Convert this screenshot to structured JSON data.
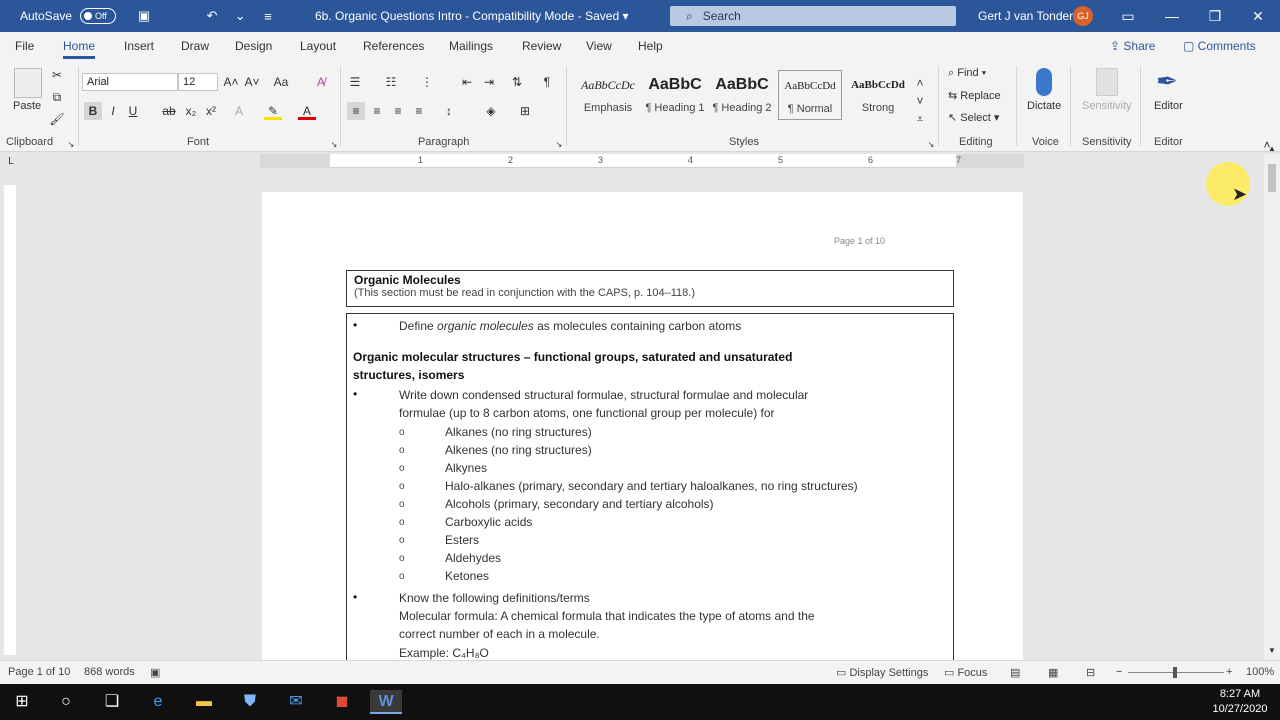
{
  "titlebar": {
    "autosave_label": "AutoSave",
    "autosave_state": "Off",
    "doc_title": "6b. Organic Questions Intro  -  Compatibility Mode  -  Saved",
    "search_placeholder": "Search",
    "user_name": "Gert J van Tonder",
    "user_initials": "GJ"
  },
  "tabs": [
    "File",
    "Home",
    "Insert",
    "Draw",
    "Design",
    "Layout",
    "References",
    "Mailings",
    "Review",
    "View",
    "Help"
  ],
  "active_tab": "Home",
  "share_label": "Share",
  "comments_label": "Comments",
  "ribbon": {
    "clipboard": {
      "paste": "Paste",
      "label": "Clipboard"
    },
    "font": {
      "name": "Arial",
      "size": "12",
      "label": "Font"
    },
    "paragraph": {
      "label": "Paragraph"
    },
    "styles": {
      "label": "Styles",
      "items": [
        {
          "sample": "AaBbCcDc",
          "name": "Emphasis"
        },
        {
          "sample": "AaBbC",
          "name": "¶ Heading 1"
        },
        {
          "sample": "AaBbC",
          "name": "¶ Heading 2"
        },
        {
          "sample": "AaBbCcDd",
          "name": "¶ Normal"
        },
        {
          "sample": "AaBbCcDd",
          "name": "Strong"
        }
      ]
    },
    "editing": {
      "find": "Find",
      "replace": "Replace",
      "select": "Select",
      "label": "Editing"
    },
    "voice": {
      "dictate": "Dictate",
      "label": "Voice"
    },
    "sensitivity": {
      "button": "Sensitivity",
      "label": "Sensitivity"
    },
    "editor": {
      "button": "Editor",
      "label": "Editor"
    }
  },
  "ruler_numbers": [
    "1",
    "2",
    "3",
    "4",
    "5",
    "6",
    "7"
  ],
  "document": {
    "page_header": "Page 1 of 10",
    "box1_title": "Organic Molecules",
    "box1_sub": "(This section must be read in conjunction with the CAPS, p. 104–118.)",
    "define_prefix": "Define ",
    "define_italic": "organic molecules",
    "define_suffix": " as molecules containing carbon atoms",
    "heading_line1": "Organic  molecular  structures  –  functional  groups,  saturated  and  unsaturated",
    "heading_line2": "structures, isomers",
    "write_line1": "Write  down  condensed  structural  formulae,  structural  formulae  and  molecular",
    "write_line2": "formulae (up to 8 carbon atoms, one functional group per molecule) for",
    "sub_items": [
      "Alkanes (no ring structures)",
      "Alkenes (no ring structures)",
      "Alkynes",
      "Halo-alkanes (primary, secondary and tertiary haloalkanes, no ring structures)",
      "Alcohols (primary, secondary and tertiary alcohols)",
      "Carboxylic acids",
      "Esters",
      "Aldehydes",
      "Ketones"
    ],
    "know_line": "Know the following definitions/terms",
    "mf_line1": "Molecular  formula:  A  chemical  formula  that  indicates  the  type  of  atoms  and  the",
    "mf_line2": "correct number of each in a molecule.",
    "example": "Example: C₄H₈O"
  },
  "statusbar": {
    "page": "Page 1 of 10",
    "words": "868 words",
    "display_settings": "Display Settings",
    "focus": "Focus",
    "zoom": "100%"
  },
  "clock": {
    "time": "8:27 AM",
    "date": "10/27/2020"
  },
  "colors": {
    "brand": "#2b579a",
    "avatar": "#d9622b",
    "taskbar": "#101010"
  }
}
